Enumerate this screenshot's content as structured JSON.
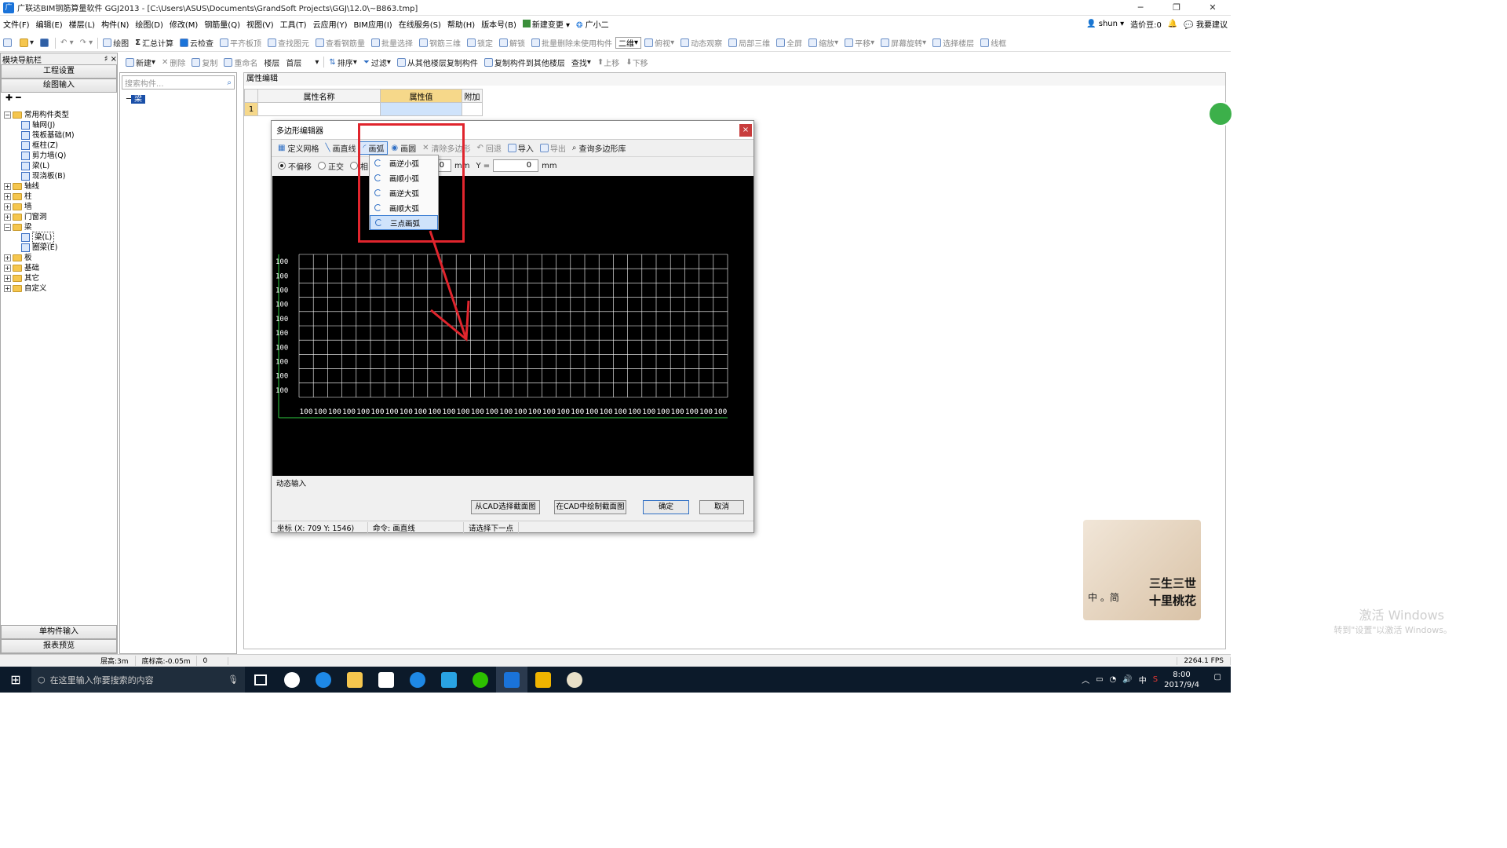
{
  "title_bar": {
    "text": "广联达BIM钢筋算量软件 GGJ2013 - [C:\\Users\\ASUS\\Documents\\GrandSoft Projects\\GGJ\\12.0\\~B863.tmp]"
  },
  "menu": {
    "items": [
      "文件(F)",
      "编辑(E)",
      "楼层(L)",
      "构件(N)",
      "绘图(D)",
      "修改(M)",
      "钢筋量(Q)",
      "视图(V)",
      "工具(T)",
      "云应用(Y)",
      "BIM应用(I)",
      "在线服务(S)",
      "帮助(H)",
      "版本号(B)",
      "新建变更",
      "广小二"
    ],
    "user": "shun",
    "beans": "造价豆:0",
    "suggest": "我要建议"
  },
  "toolbar1": {
    "items": [
      "绘图",
      "汇总计算",
      "云检查",
      "平齐板顶",
      "查找图元",
      "查看钢筋量",
      "批量选择",
      "钢筋三维",
      "锁定",
      "解锁",
      "批量删除未使用构件",
      "二维",
      "俯视",
      "动态观察",
      "局部三维",
      "全屏",
      "缩放",
      "平移",
      "屏幕旋转",
      "选择楼层",
      "线框"
    ]
  },
  "toolbar2": {
    "items": [
      "新建",
      "删除",
      "复制",
      "重命名",
      "楼层",
      "首层",
      "排序",
      "过滤",
      "从其他楼层复制构件",
      "复制构件到其他楼层",
      "查找",
      "上移",
      "下移"
    ]
  },
  "left_nav": {
    "header": "模块导航栏",
    "pin": "♯ ×",
    "btn_top": [
      "工程设置",
      "绘图输入"
    ],
    "btn_bottom": [
      "单构件输入",
      "报表预览"
    ],
    "tree": [
      {
        "t": "常用构件类型",
        "lvl": 0,
        "type": "folder",
        "exp": "−"
      },
      {
        "t": "轴网(J)",
        "lvl": 1,
        "type": "comp"
      },
      {
        "t": "筏板基础(M)",
        "lvl": 1,
        "type": "comp"
      },
      {
        "t": "框柱(Z)",
        "lvl": 1,
        "type": "comp"
      },
      {
        "t": "剪力墙(Q)",
        "lvl": 1,
        "type": "comp"
      },
      {
        "t": "梁(L)",
        "lvl": 1,
        "type": "comp"
      },
      {
        "t": "现浇板(B)",
        "lvl": 1,
        "type": "comp"
      },
      {
        "t": "轴线",
        "lvl": 0,
        "type": "folder",
        "exp": "+"
      },
      {
        "t": "柱",
        "lvl": 0,
        "type": "folder",
        "exp": "+"
      },
      {
        "t": "墙",
        "lvl": 0,
        "type": "folder",
        "exp": "+"
      },
      {
        "t": "门窗洞",
        "lvl": 0,
        "type": "folder",
        "exp": "+"
      },
      {
        "t": "梁",
        "lvl": 0,
        "type": "folder",
        "exp": "−"
      },
      {
        "t": "梁(L)",
        "lvl": 1,
        "type": "comp"
      },
      {
        "t": "圈梁(E)",
        "lvl": 1,
        "type": "comp"
      },
      {
        "t": "板",
        "lvl": 0,
        "type": "folder",
        "exp": "+"
      },
      {
        "t": "基础",
        "lvl": 0,
        "type": "folder",
        "exp": "+"
      },
      {
        "t": "其它",
        "lvl": 0,
        "type": "folder",
        "exp": "+"
      },
      {
        "t": "自定义",
        "lvl": 0,
        "type": "folder",
        "exp": "+"
      }
    ]
  },
  "comp_panel": {
    "search_placeholder": "搜索构件...",
    "root": "梁"
  },
  "prop": {
    "tab": "属性编辑",
    "col_name": "属性名称",
    "col_value": "属性值",
    "col_extra": "附加",
    "row1": "1"
  },
  "dialog": {
    "title": "多边形编辑器",
    "close": "×",
    "toolbar": [
      "定义网格",
      "画直线",
      "画弧",
      "画圆",
      "清除多边形",
      "回退",
      "导入",
      "导出",
      "查询多边形库"
    ],
    "opts": {
      "r1": "不偏移",
      "r2": "正交",
      "r3": "相",
      "x_value": "0",
      "unit": "mm",
      "y_label": "Y =",
      "y_value": "0",
      "unit2": "mm"
    },
    "arc_menu": [
      "画逆小弧",
      "画顺小弧",
      "画逆大弧",
      "画顺大弧",
      "三点画弧"
    ],
    "grid": {
      "label": "100",
      "rows": 10,
      "cols": 30
    },
    "dyn_label": "动态输入",
    "buttons": {
      "cad_select": "从CAD选择截面图",
      "cad_draw": "在CAD中绘制截面图",
      "ok": "确定",
      "cancel": "取消"
    },
    "status": {
      "coord": "坐标 (X: 709 Y: 1546)",
      "cmd": "命令: 画直线",
      "hint": "请选择下一点"
    }
  },
  "statusbar": {
    "floor_h": "层高:3m",
    "base_h": "底标高:-0.05m",
    "v": "0",
    "fps": "2264.1 FPS"
  },
  "taskbar": {
    "search": "在这里输入你要搜索的内容",
    "time": "8:00",
    "date": "2017/9/4",
    "ime": "中"
  },
  "watermark": {
    "line1": "激活 Windows",
    "line2": "转到\"设置\"以激活 Windows。"
  },
  "ad": {
    "text1": "三生三世",
    "text2": "十里桃花",
    "ime_chars": "中 。简"
  },
  "colors": {
    "red": "#e0252d",
    "grid": "#ffffff",
    "axis_green": "#2ecc40",
    "canvas": "#000000"
  }
}
